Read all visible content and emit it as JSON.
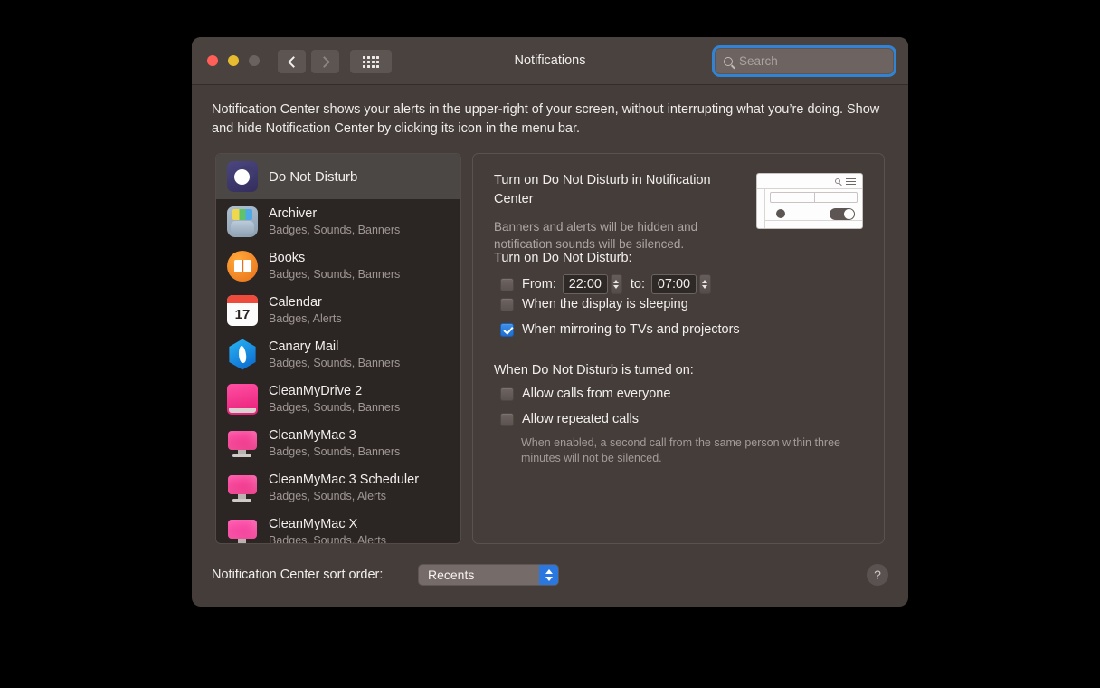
{
  "window": {
    "title": "Notifications",
    "traffic": {
      "close": "close-button",
      "minimize": "minimize-button",
      "zoom": "zoom-button"
    },
    "toolbar": {
      "back_label": "",
      "forward_label": "",
      "grid_label": "",
      "search_placeholder": "Search",
      "search_value": ""
    }
  },
  "description": "Notification Center shows your alerts in the upper-right of your screen, without interrupting what you’re doing. Show and hide Notification Center by clicking its icon in the menu bar.",
  "sidebar": {
    "items": [
      {
        "name": "Do Not Disturb",
        "detail": "",
        "icon": "do-not-disturb-icon",
        "selected": true
      },
      {
        "name": "Archiver",
        "detail": "Badges, Sounds, Banners",
        "icon": "archiver-icon",
        "selected": false
      },
      {
        "name": "Books",
        "detail": "Badges, Sounds, Banners",
        "icon": "books-icon",
        "selected": false
      },
      {
        "name": "Calendar",
        "detail": "Badges, Alerts",
        "icon": "calendar-icon",
        "selected": false
      },
      {
        "name": "Canary Mail",
        "detail": "Badges, Sounds, Banners",
        "icon": "canary-mail-icon",
        "selected": false
      },
      {
        "name": "CleanMyDrive 2",
        "detail": "Badges, Sounds, Banners",
        "icon": "cleanmydrive-icon",
        "selected": false
      },
      {
        "name": "CleanMyMac 3",
        "detail": "Badges, Sounds, Banners",
        "icon": "cleanmymac3-icon",
        "selected": false
      },
      {
        "name": "CleanMyMac 3 Scheduler",
        "detail": "Badges, Sounds, Alerts",
        "icon": "cleanmymac3-scheduler-icon",
        "selected": false
      },
      {
        "name": "CleanMyMac X",
        "detail": "Badges, Sounds, Alerts",
        "icon": "cleanmymacx-icon",
        "selected": false
      }
    ],
    "calendar_day": "17"
  },
  "detail": {
    "title": "Turn on Do Not Disturb in Notification Center",
    "subtitle": "Banners and alerts will be hidden and notification sounds will be silenced.",
    "section_schedule_label": "Turn on Do Not Disturb:",
    "from_label": "From:",
    "from_value": "22:00",
    "to_label": "to:",
    "to_value": "07:00",
    "display_sleeping_label": "When the display is sleeping",
    "mirroring_label": "When mirroring to TVs and projectors",
    "section_when_on_label": "When Do Not Disturb is turned on:",
    "allow_calls_label": "Allow calls from everyone",
    "allow_repeated_label": "Allow repeated calls",
    "repeated_note": "When enabled, a second call from the same person within three minutes will not be silenced.",
    "checked": {
      "from": false,
      "display_sleeping": false,
      "mirroring": true,
      "allow_calls": false,
      "allow_repeated": false
    }
  },
  "footer": {
    "sort_label": "Notification Center sort order:",
    "sort_value": "Recents",
    "help_label": "?"
  },
  "colors": {
    "window_bg": "#453D3A",
    "titlebar_bg": "#4A423F",
    "sidebar_bg": "#2B2523",
    "selection": "#4B4745",
    "accent_blue": "#2B77E0",
    "focus_ring": "#3287DC",
    "text_primary": "#F2EFEE",
    "text_secondary": "#9F9794"
  }
}
